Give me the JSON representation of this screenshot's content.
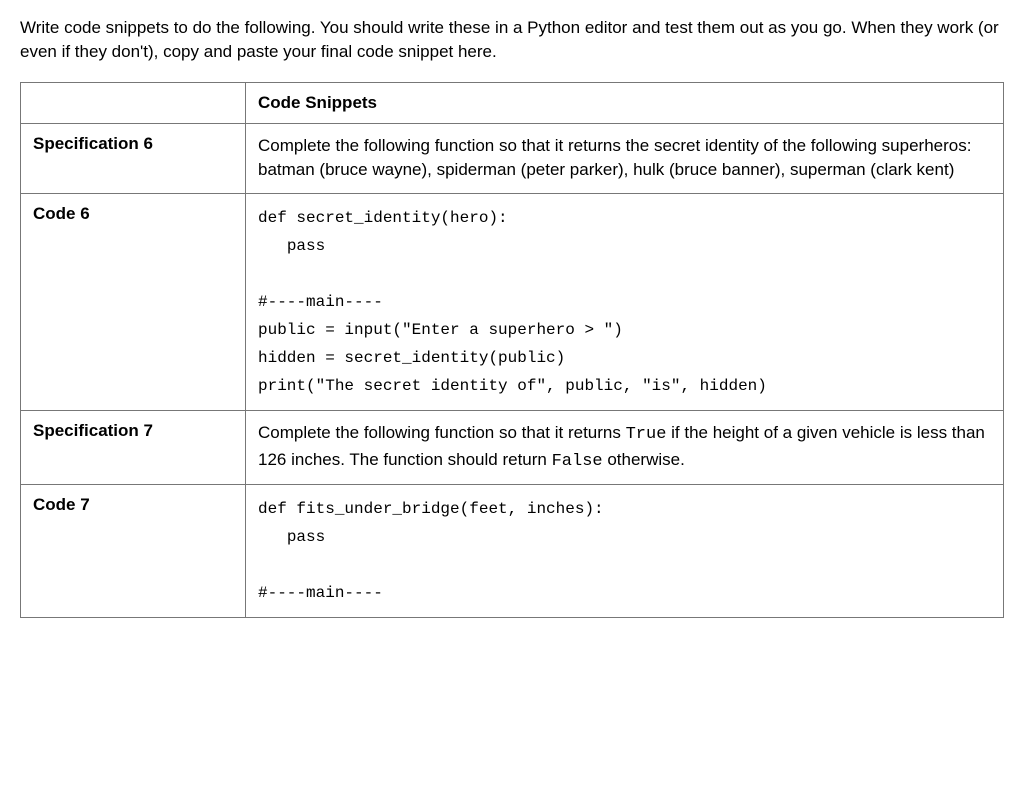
{
  "intro": "Write code snippets to do the following. You should write these in a Python editor and test them out as you go. When they work (or even if they don't), copy and paste your final code snippet here.",
  "header": {
    "col2": "Code Snippets"
  },
  "rows": {
    "spec6_label": "Specification 6",
    "spec6_text": "Complete the following function so that it returns the secret identity of the following superheros: batman (bruce wayne), spiderman (peter parker), hulk (bruce banner), superman (clark kent)",
    "code6_label": "Code 6",
    "code6_text": "def secret_identity(hero):\n   pass\n\n#----main----\npublic = input(\"Enter a superhero > \")\nhidden = secret_identity(public)\nprint(\"The secret identity of\", public, \"is\", hidden)",
    "spec7_label": "Specification 7",
    "spec7_pre": "Complete the following function so that it returns ",
    "spec7_true": "True",
    "spec7_mid": " if the height of a given vehicle is less than 126 inches. The function should return ",
    "spec7_false": "False",
    "spec7_post": " otherwise.",
    "code7_label": "Code 7",
    "code7_text": "def fits_under_bridge(feet, inches):\n   pass\n\n#----main----"
  }
}
